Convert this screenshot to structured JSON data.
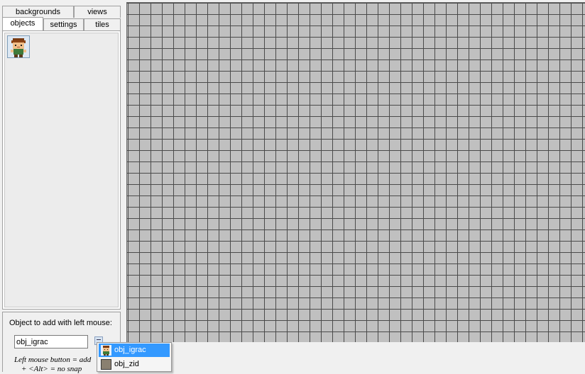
{
  "tabs": {
    "row1": [
      {
        "label": "backgrounds",
        "id": "backgrounds"
      },
      {
        "label": "views",
        "id": "views"
      }
    ],
    "row2": [
      {
        "label": "objects",
        "id": "objects",
        "active": true
      },
      {
        "label": "settings",
        "id": "settings"
      },
      {
        "label": "tiles",
        "id": "tiles"
      }
    ]
  },
  "objects_panel": {
    "thumbnail_icon": "character-sprite-icon",
    "add_label": "Object to add with left mouse:",
    "selected_object": "obj_igrac",
    "menu_icon": "menu-list-icon",
    "hint_line1": "Left mouse button = add",
    "hint_line2": "+ <Alt> = no snap"
  },
  "room": {
    "background_color": "#c0c0c0",
    "grid_color": "#4a4a4a",
    "grid_visible": true
  },
  "popup_menu": {
    "items": [
      {
        "label": "obj_igrac",
        "icon": "character-sprite-icon",
        "selected": true
      },
      {
        "label": "obj_zid",
        "icon": "wall-block-icon",
        "selected": false
      }
    ],
    "highlight_color": "#3399ff"
  }
}
